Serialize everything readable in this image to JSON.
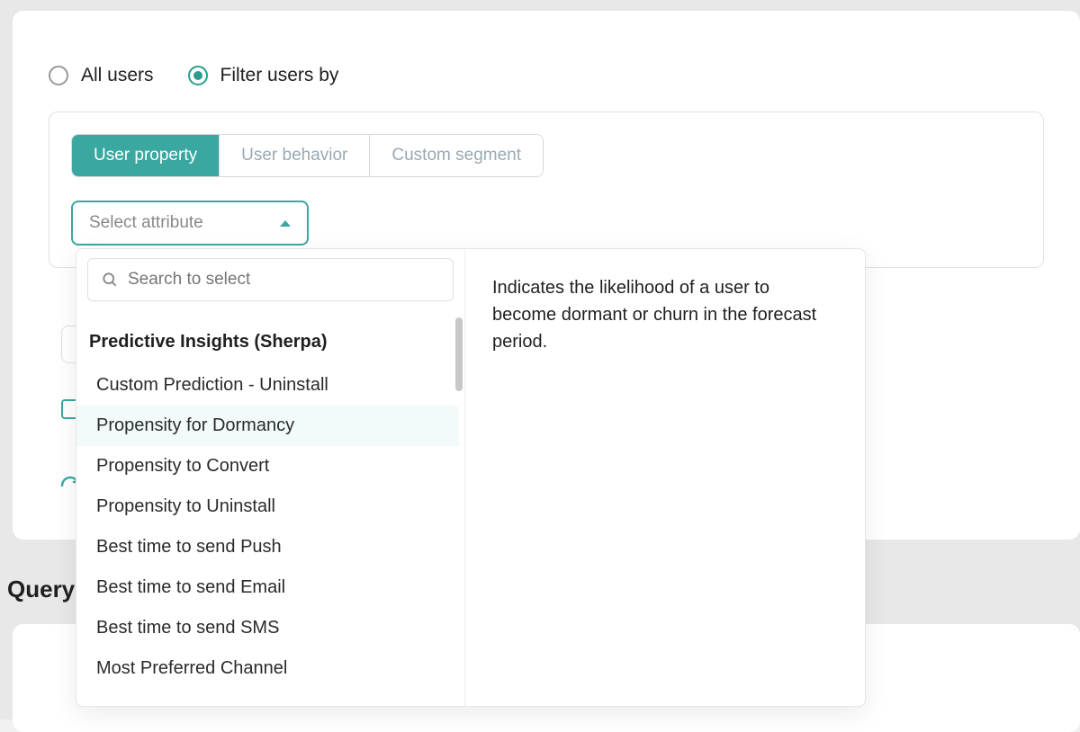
{
  "radios": {
    "all_users": "All users",
    "filter_by": "Filter users by"
  },
  "tabs": {
    "user_property": "User property",
    "user_behavior": "User behavior",
    "custom_segment": "Custom segment"
  },
  "select_attribute_label": "Select attribute",
  "search_placeholder": "Search to select",
  "dropdown": {
    "group_header": "Predictive Insights (Sherpa)",
    "items": [
      "Custom Prediction - Uninstall",
      "Propensity for Dormancy",
      "Propensity to Convert",
      "Propensity to Uninstall",
      "Best time to send Push",
      "Best time to send Email",
      "Best time to send SMS",
      "Most Preferred Channel"
    ],
    "highlighted_index": 1,
    "description": "Indicates the likelihood of a user to become dormant or churn in the forecast period."
  },
  "query_heading": "Query"
}
